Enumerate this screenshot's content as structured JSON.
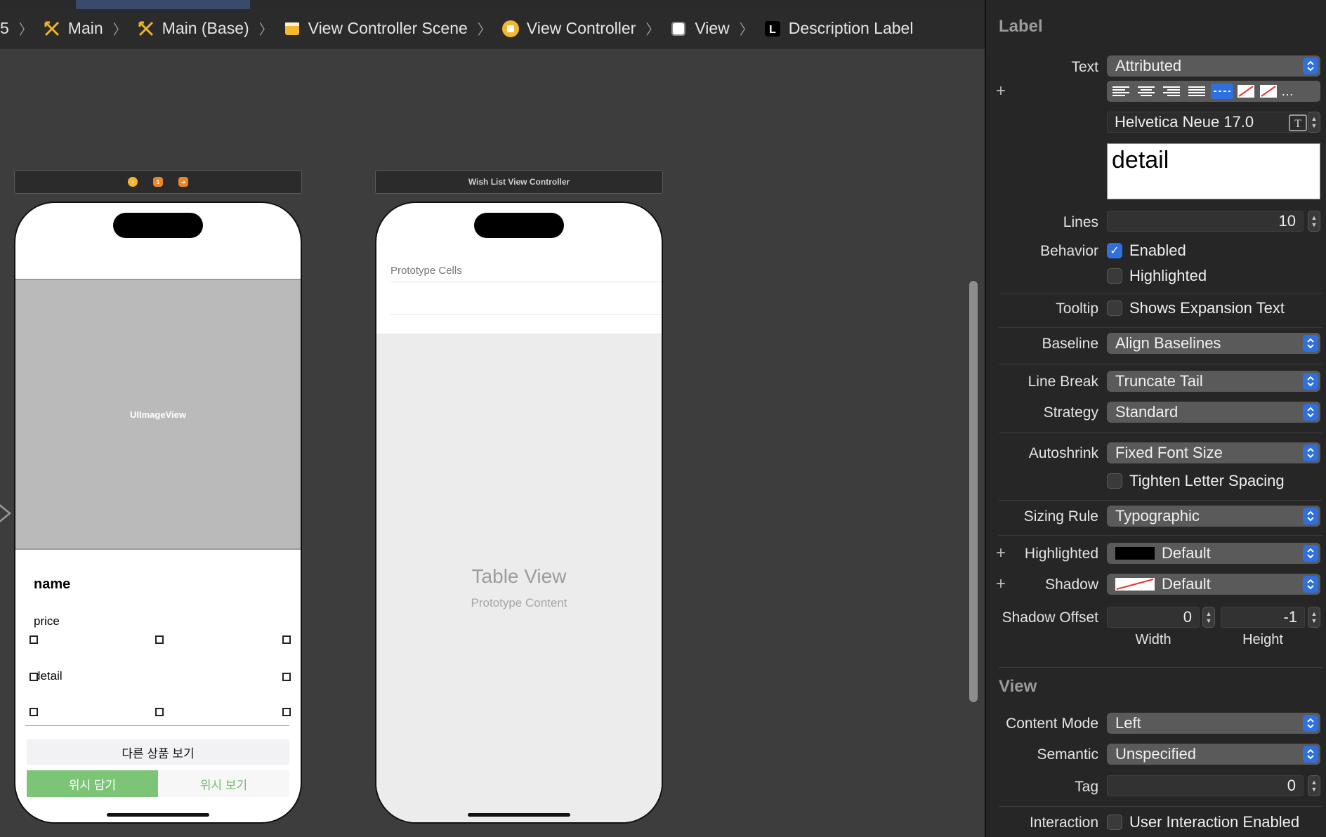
{
  "jumpbar": {
    "crumbs": [
      {
        "label": "5"
      },
      {
        "label": "Main"
      },
      {
        "label": "Main (Base)"
      },
      {
        "label": "View Controller Scene"
      },
      {
        "label": "View Controller"
      },
      {
        "label": "View"
      },
      {
        "label": "Description Label"
      }
    ]
  },
  "scene1": {
    "imageview_label": "UIImageView",
    "name_label": "name",
    "price_label": "price",
    "detail_label": "detail",
    "other_button": "다른 상품 보기",
    "wish_add_button": "위시 담기",
    "wish_view_button": "위시 보기"
  },
  "scene2": {
    "title": "Wish List View Controller",
    "prototype_cells": "Prototype Cells",
    "table_view": "Table View",
    "prototype_content": "Prototype Content"
  },
  "inspector": {
    "label_section": "Label",
    "text_label": "Text",
    "text_value": "Attributed",
    "font_value": "Helvetica Neue 17.0",
    "text_content": "detail",
    "lines_label": "Lines",
    "lines_value": "10",
    "behavior_label": "Behavior",
    "enabled_label": "Enabled",
    "highlighted_chk_label": "Highlighted",
    "tooltip_label": "Tooltip",
    "tooltip_value": "Shows Expansion Text",
    "baseline_label": "Baseline",
    "baseline_value": "Align Baselines",
    "linebreak_label": "Line Break",
    "linebreak_value": "Truncate Tail",
    "strategy_label": "Strategy",
    "strategy_value": "Standard",
    "autoshrink_label": "Autoshrink",
    "autoshrink_value": "Fixed Font Size",
    "tighten_label": "Tighten Letter Spacing",
    "sizing_label": "Sizing Rule",
    "sizing_value": "Typographic",
    "highlighted_label": "Highlighted",
    "highlighted_value": "Default",
    "shadow_label": "Shadow",
    "shadow_value": "Default",
    "shadow_offset_label": "Shadow Offset",
    "offset_width_value": "0",
    "offset_height_value": "-1",
    "width_label": "Width",
    "height_label": "Height",
    "view_section": "View",
    "content_mode_label": "Content Mode",
    "content_mode_value": "Left",
    "semantic_label": "Semantic",
    "semantic_value": "Unspecified",
    "tag_label": "Tag",
    "tag_value": "0",
    "interaction_label": "Interaction",
    "interaction_value": "User Interaction Enabled"
  },
  "colors": {
    "accent": "#2f6fe0",
    "wish_green": "#7cc577"
  }
}
